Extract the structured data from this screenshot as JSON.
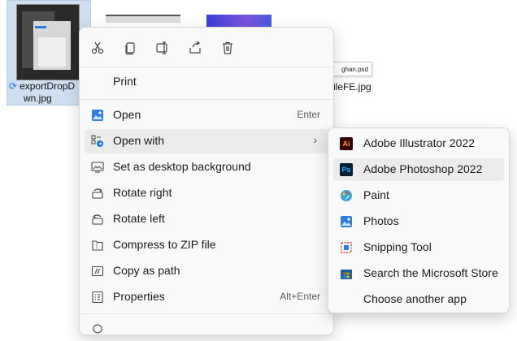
{
  "desktop": {
    "selected_file": {
      "name_line1": "exportDropD",
      "name_line2": "wn.jpg"
    },
    "bg_file_name": "ileFE.jpg",
    "psd_card": "ghan.psd"
  },
  "context_menu": {
    "toolbar": [
      "cut-icon",
      "copy-icon",
      "rename-icon",
      "share-icon",
      "delete-icon"
    ],
    "print": "Print",
    "items": [
      {
        "label": "Open",
        "shortcut": "Enter",
        "icon": "photos-icon"
      },
      {
        "label": "Open with",
        "shortcut": "",
        "icon": "open-with-icon"
      },
      {
        "label": "Set as desktop background",
        "shortcut": "",
        "icon": "desktop-background-icon"
      },
      {
        "label": "Rotate right",
        "shortcut": "",
        "icon": "rotate-right-icon"
      },
      {
        "label": "Rotate left",
        "shortcut": "",
        "icon": "rotate-left-icon"
      },
      {
        "label": "Compress to ZIP file",
        "shortcut": "",
        "icon": "zip-icon"
      },
      {
        "label": "Copy as path",
        "shortcut": "",
        "icon": "copy-path-icon"
      },
      {
        "label": "Properties",
        "shortcut": "Alt+Enter",
        "icon": "properties-icon"
      }
    ]
  },
  "open_with_submenu": {
    "items": [
      {
        "label": "Adobe Illustrator 2022",
        "icon": "illustrator-icon",
        "badge": "Ai"
      },
      {
        "label": "Adobe Photoshop 2022",
        "icon": "photoshop-icon",
        "badge": "Ps"
      },
      {
        "label": "Paint",
        "icon": "paint-icon"
      },
      {
        "label": "Photos",
        "icon": "photos-icon"
      },
      {
        "label": "Snipping Tool",
        "icon": "snipping-tool-icon"
      },
      {
        "label": "Search the Microsoft Store",
        "icon": "store-icon"
      },
      {
        "label": "Choose another app",
        "icon": ""
      }
    ]
  },
  "colors": {
    "accent": "#1a73e8",
    "menu_bg": "#f9f9f9",
    "hover_bg": "#ebebeb"
  }
}
